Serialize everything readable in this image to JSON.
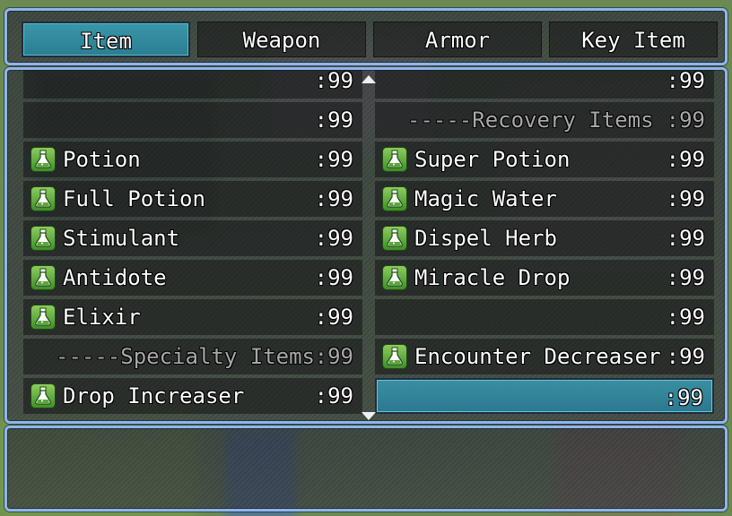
{
  "tabs": [
    {
      "label": "Item"
    },
    {
      "label": "Weapon"
    },
    {
      "label": "Armor"
    },
    {
      "label": "Key Item"
    }
  ],
  "left_items": [
    {
      "name": "",
      "qty": ":99",
      "icon": "none",
      "dim": false
    },
    {
      "name": "",
      "qty": ":99",
      "icon": "none",
      "dim": false
    },
    {
      "name": "Potion",
      "qty": ":99",
      "icon": "potion-icon",
      "dim": false
    },
    {
      "name": "Full Potion",
      "qty": ":99",
      "icon": "potion-icon",
      "dim": false
    },
    {
      "name": "Stimulant",
      "qty": ":99",
      "icon": "potion-icon",
      "dim": false
    },
    {
      "name": "Antidote",
      "qty": ":99",
      "icon": "potion-icon",
      "dim": false
    },
    {
      "name": "Elixir",
      "qty": ":99",
      "icon": "potion-icon",
      "dim": false
    },
    {
      "name": "-----Specialty Items",
      "qty": ":99",
      "icon": "none",
      "dim": true
    },
    {
      "name": "Drop Increaser",
      "qty": ":99",
      "icon": "potion-icon",
      "dim": false
    }
  ],
  "right_items": [
    {
      "name": "",
      "qty": ":99",
      "icon": "none",
      "dim": false
    },
    {
      "name": "-----Recovery Items",
      "qty": ":99",
      "icon": "none",
      "dim": true
    },
    {
      "name": "Super Potion",
      "qty": ":99",
      "icon": "potion-icon",
      "dim": false
    },
    {
      "name": "Magic Water",
      "qty": ":99",
      "icon": "potion-icon",
      "dim": false
    },
    {
      "name": "Dispel Herb",
      "qty": ":99",
      "icon": "potion-icon",
      "dim": false
    },
    {
      "name": "Miracle Drop",
      "qty": ":99",
      "icon": "potion-icon",
      "dim": false
    },
    {
      "name": "",
      "qty": ":99",
      "icon": "none",
      "dim": false
    },
    {
      "name": "Encounter Decreaser",
      "qty": ":99",
      "icon": "potion-icon",
      "dim": false
    },
    {
      "name": "",
      "qty": ":99",
      "icon": "none",
      "dim": false,
      "selected": true
    }
  ],
  "help_text": "",
  "colors": {
    "window_border": "#8fb6e8",
    "selection": "#2f86a0",
    "icon_green": "#5aa83a"
  }
}
